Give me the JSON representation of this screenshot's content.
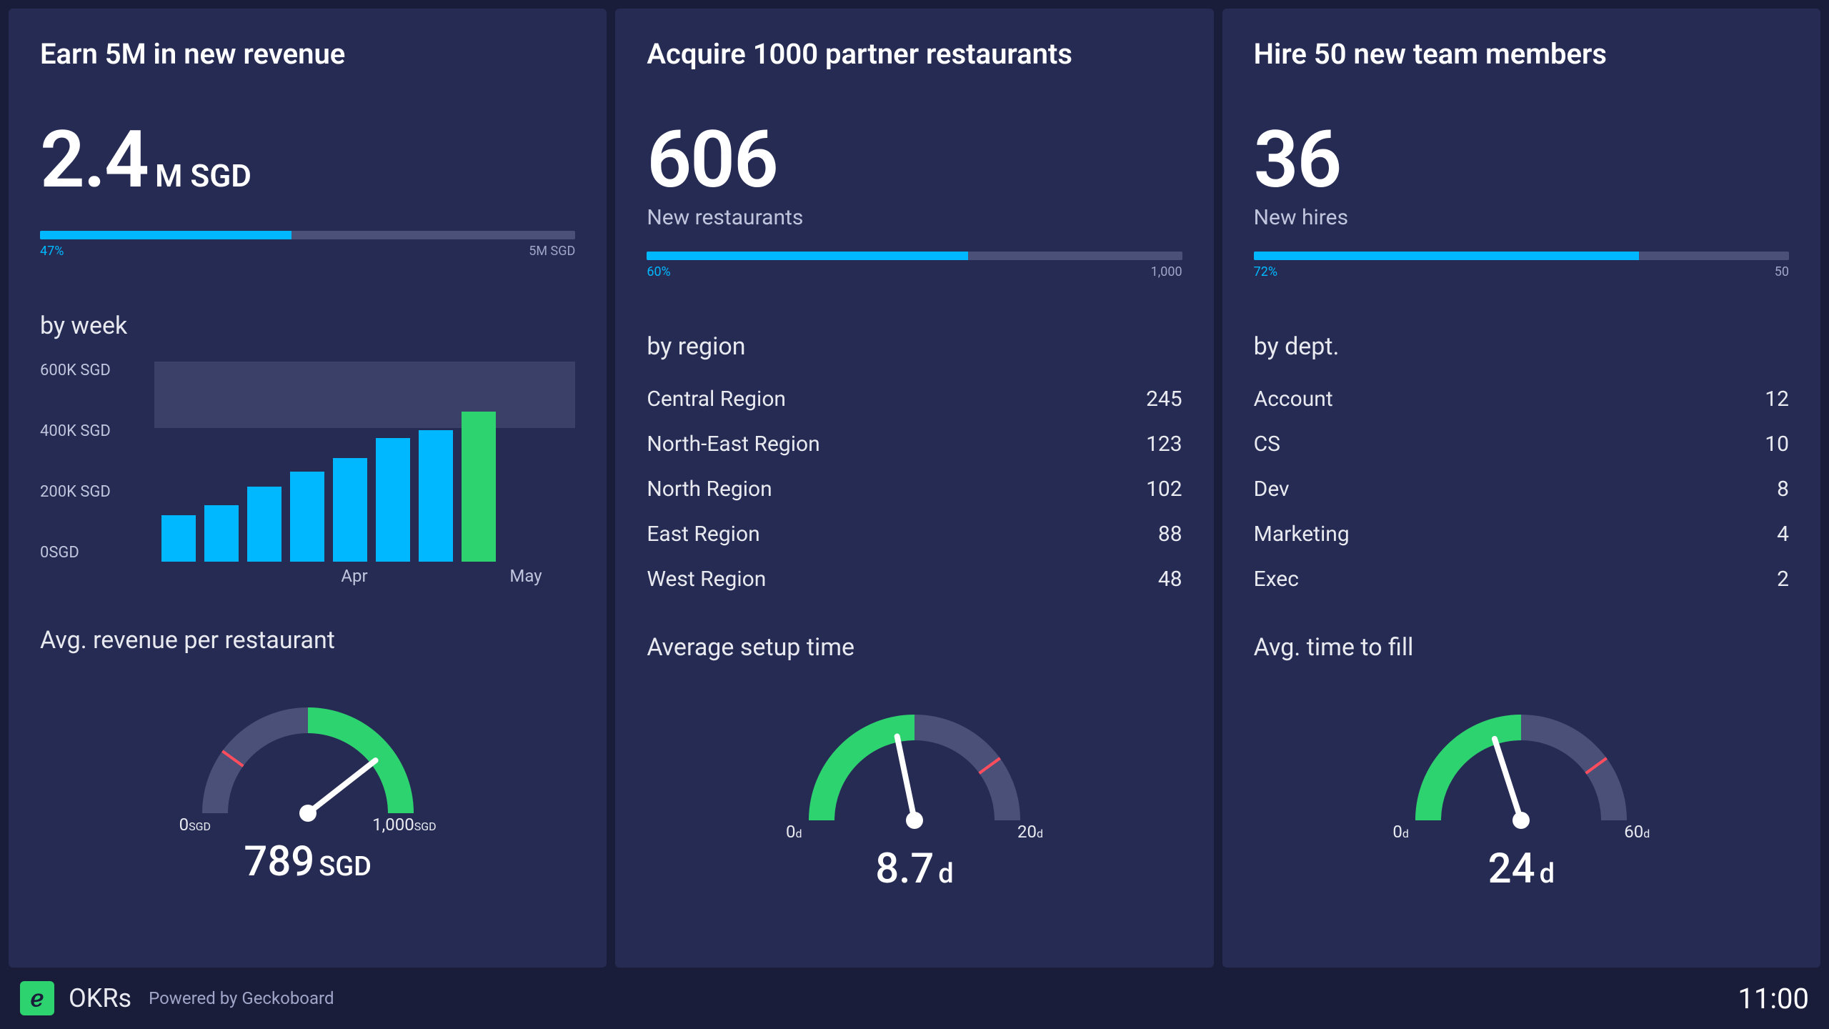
{
  "cards": [
    {
      "title": "Earn 5M in new revenue",
      "metric_value": "2.4",
      "metric_unit": "M SGD",
      "metric_sublabel": "",
      "progress_pct": 47,
      "progress_left": "47%",
      "progress_right": "5M SGD",
      "section1_title": "by week",
      "section2_title": "Avg. revenue per restaurant",
      "gauge": {
        "min": "0",
        "max": "1,000",
        "unit": "SGD",
        "value": "789",
        "pct": 78.9,
        "green_start": 50,
        "green_end": 100,
        "red_at": 20
      }
    },
    {
      "title": "Acquire 1000 partner restaurants",
      "metric_value": "606",
      "metric_unit": "",
      "metric_sublabel": "New restaurants",
      "progress_pct": 60,
      "progress_left": "60%",
      "progress_right": "1,000",
      "section1_title": "by region",
      "section2_title": "Average setup time",
      "list": [
        {
          "label": "Central Region",
          "value": "245"
        },
        {
          "label": "North-East Region",
          "value": "123"
        },
        {
          "label": "North Region",
          "value": "102"
        },
        {
          "label": "East Region",
          "value": "88"
        },
        {
          "label": "West Region",
          "value": "48"
        }
      ],
      "gauge": {
        "min": "0",
        "max": "20",
        "unit": "d",
        "value": "8.7",
        "pct": 43.5,
        "green_start": 0,
        "green_end": 50,
        "red_at": 80
      }
    },
    {
      "title": "Hire 50 new team members",
      "metric_value": "36",
      "metric_unit": "",
      "metric_sublabel": "New hires",
      "progress_pct": 72,
      "progress_left": "72%",
      "progress_right": "50",
      "section1_title": "by dept.",
      "section2_title": "Avg. time to fill",
      "list": [
        {
          "label": "Account",
          "value": "12"
        },
        {
          "label": "CS",
          "value": "10"
        },
        {
          "label": "Dev",
          "value": "8"
        },
        {
          "label": "Marketing",
          "value": "4"
        },
        {
          "label": "Exec",
          "value": "2"
        }
      ],
      "gauge": {
        "min": "0",
        "max": "60",
        "unit": "d",
        "value": "24",
        "pct": 40,
        "green_start": 0,
        "green_end": 50,
        "red_at": 80
      }
    }
  ],
  "chart_data": {
    "type": "bar",
    "title": "by week",
    "y_ticks": [
      "600K SGD",
      "400K SGD",
      "200K SGD",
      "0SGD"
    ],
    "ylim": [
      0,
      600
    ],
    "target_band": [
      400,
      600
    ],
    "x_labels": [
      "",
      "",
      "",
      "",
      "Apr",
      "",
      "",
      "",
      "May"
    ],
    "values": [
      140,
      170,
      225,
      270,
      310,
      370,
      395,
      450
    ],
    "highlight_index": 7,
    "unit": "K SGD",
    "xlabel": "",
    "ylabel": ""
  },
  "footer": {
    "title": "OKRs",
    "powered": "Powered by Geckoboard",
    "clock": "11:00"
  }
}
